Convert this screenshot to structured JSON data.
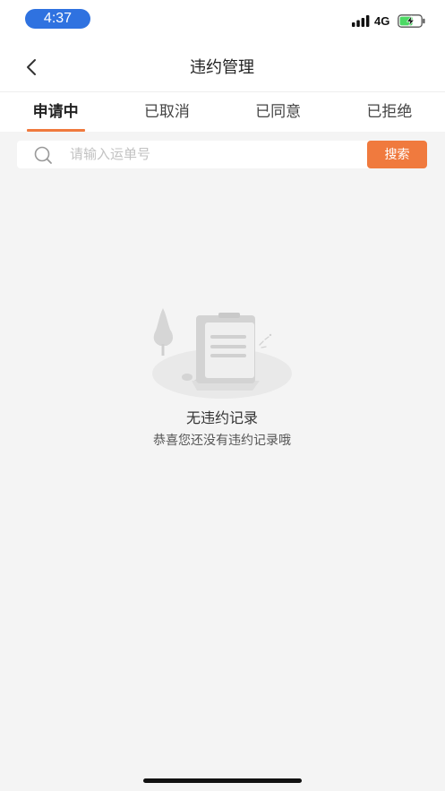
{
  "status_bar": {
    "time": "4:37",
    "network": "4G",
    "icons": {
      "signal": "signal-icon",
      "battery": "battery-charging-icon"
    }
  },
  "nav": {
    "title": "违约管理",
    "back_icon": "chevron-left-icon"
  },
  "tabs": [
    {
      "label": "申请中",
      "active": true
    },
    {
      "label": "已取消",
      "active": false
    },
    {
      "label": "已同意",
      "active": false
    },
    {
      "label": "已拒绝",
      "active": false
    }
  ],
  "search": {
    "icon": "search-icon",
    "placeholder": "请输入运单号",
    "value": "",
    "button_label": "搜索"
  },
  "empty_state": {
    "illustration": "empty-clipboard-illustration",
    "title": "无违约记录",
    "subtitle": "恭喜您还没有违约记录哦"
  },
  "colors": {
    "accent": "#f07a3e",
    "time_pill": "#2f72e0",
    "battery_fill": "#4cd964",
    "page_background": "#f4f4f4",
    "header_background": "#ffffff"
  }
}
